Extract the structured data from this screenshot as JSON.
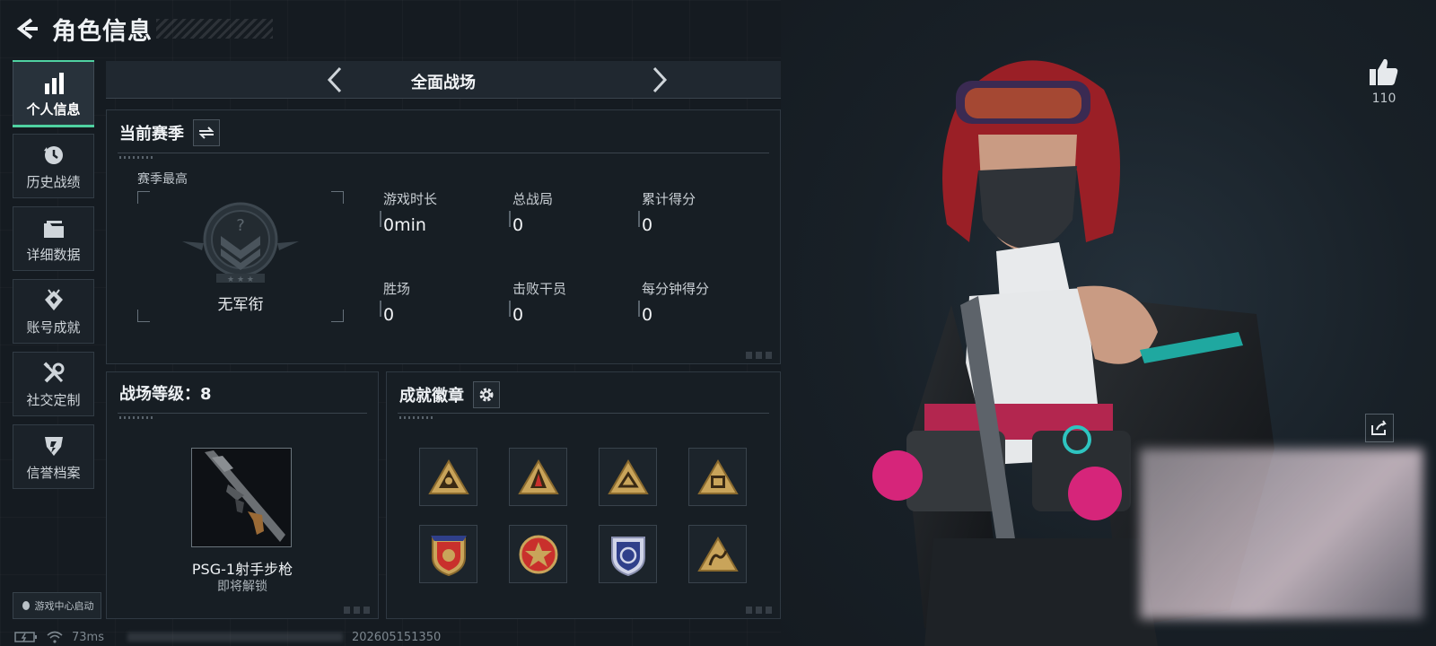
{
  "header": {
    "title": "角色信息"
  },
  "sidebar": {
    "items": [
      {
        "label": "个人信息",
        "icon": "bar-chart-icon",
        "active": true
      },
      {
        "label": "历史战绩",
        "icon": "history-clock-icon",
        "active": false
      },
      {
        "label": "详细数据",
        "icon": "folder-icon",
        "active": false
      },
      {
        "label": "账号成就",
        "icon": "achievement-icon",
        "active": false
      },
      {
        "label": "社交定制",
        "icon": "tools-icon",
        "active": false
      },
      {
        "label": "信誉档案",
        "icon": "reputation-icon",
        "active": false
      }
    ],
    "launch_label": "游戏中心启动"
  },
  "mode_selector": {
    "title": "全面战场"
  },
  "season": {
    "title": "当前赛季",
    "best_label": "赛季最高",
    "rank_name": "无军衔",
    "stats": [
      {
        "label": "游戏时长",
        "value": "0min"
      },
      {
        "label": "总战局",
        "value": "0"
      },
      {
        "label": "累计得分",
        "value": "0"
      },
      {
        "label": "胜场",
        "value": "0"
      },
      {
        "label": "击败干员",
        "value": "0"
      },
      {
        "label": "每分钟得分",
        "value": "0"
      }
    ]
  },
  "battle_level": {
    "title": "战场等级：8",
    "weapon_name": "PSG-1射手步枪",
    "weapon_status": "即将解锁"
  },
  "badges": {
    "title": "成就徽章",
    "items": [
      {
        "icon": "triangle-badge-icon",
        "color": "#c9a45a"
      },
      {
        "icon": "triangle-badge-icon",
        "color": "#c9a45a"
      },
      {
        "icon": "triangle-badge-icon",
        "color": "#c9a45a"
      },
      {
        "icon": "triangle-badge-icon",
        "color": "#c9a45a"
      },
      {
        "icon": "shield-badge-icon",
        "color": "#c9302c"
      },
      {
        "icon": "round-star-badge-icon",
        "color": "#c9302c"
      },
      {
        "icon": "shield-badge-icon",
        "color": "#2f3f8a"
      },
      {
        "icon": "triangle-badge-icon",
        "color": "#c9a45a"
      }
    ]
  },
  "likes": {
    "count": "110"
  },
  "status_bar": {
    "ping": "73ms",
    "build": "202605151350"
  },
  "colors": {
    "accent": "#4fd1a1",
    "badge_gold": "#c9a45a"
  }
}
